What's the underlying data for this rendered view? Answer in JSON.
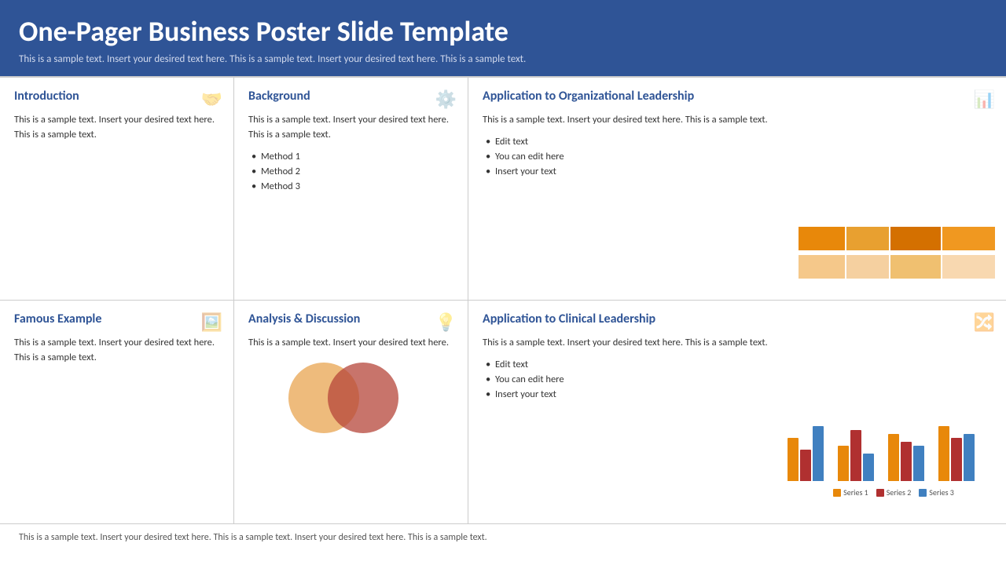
{
  "header": {
    "title": "One-Pager Business Poster Slide Template",
    "subtitle": "This is a sample text. Insert your desired text here. This is a sample text. Insert your desired text here. This is a sample text."
  },
  "cells": {
    "introduction": {
      "title": "Introduction",
      "text": "This is a sample text. Insert your desired text here. This is a sample text.",
      "icon": "🤝"
    },
    "background": {
      "title": "Background",
      "text": "This is a sample text. Insert your desired text here. This is a sample text.",
      "icon": "⚙️",
      "bullets": [
        "Method 1",
        "Method 2",
        "Method 3"
      ]
    },
    "org_leadership": {
      "title": "Application to Organizational Leadership",
      "text": "This is a sample text. Insert your desired text here. This is a sample text.",
      "icon": "📊",
      "bullets": [
        "Edit text",
        "You can edit here",
        "Insert your text"
      ],
      "chart": {
        "row1_colors": [
          "#e8880a",
          "#e8a030",
          "#d47000",
          "#f09820"
        ],
        "row1_widths": [
          60,
          55,
          65,
          70
        ],
        "row2_colors": [
          "#f5c88a",
          "#f5d0a0",
          "#f0c070",
          "#f8d8b0"
        ],
        "row2_widths": [
          60,
          55,
          65,
          70
        ]
      }
    },
    "famous_example": {
      "title": "Famous Example",
      "text": "This is a sample text. Insert your desired text here. This is a sample text.",
      "icon": "🖼️"
    },
    "analysis": {
      "title": "Analysis & Discussion",
      "text": "This is a sample text. Insert your desired text here.",
      "icon": "💡"
    },
    "clinical_leadership": {
      "title": "Application to Clinical Leadership",
      "text": "This is a sample text. Insert your desired text here. This is a sample text.",
      "icon": "🔀",
      "bullets": [
        "Edit text",
        "You can edit here",
        "Insert your text"
      ],
      "chart": {
        "groups": [
          {
            "s1": 55,
            "s2": 40,
            "s3": 70
          },
          {
            "s1": 45,
            "s2": 65,
            "s3": 35
          },
          {
            "s1": 60,
            "s2": 50,
            "s3": 45
          },
          {
            "s1": 70,
            "s2": 55,
            "s3": 60
          }
        ],
        "colors": {
          "s1": "#e8880a",
          "s2": "#b03030",
          "s3": "#4080c0"
        },
        "legend": [
          "Series 1",
          "Series 2",
          "Series 3"
        ]
      }
    }
  },
  "footer": {
    "text": "This is a sample text. Insert your desired text here. This is a sample text. Insert your desired text here. This is a sample text."
  }
}
